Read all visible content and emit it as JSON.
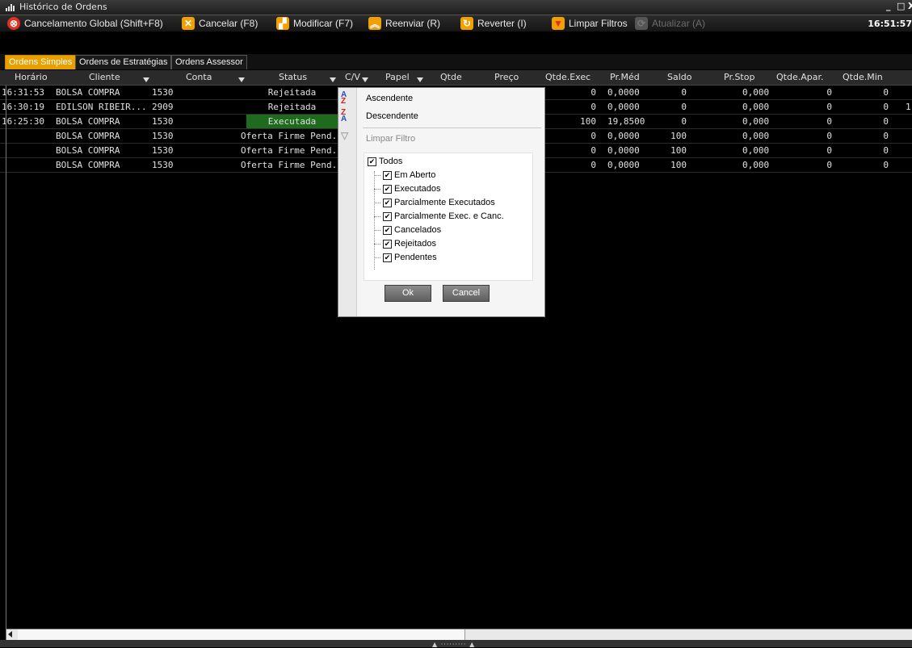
{
  "window": {
    "title": "Histórico de Ordens",
    "minimize": "_",
    "maximize": "□",
    "close": "X"
  },
  "toolbar": {
    "global_cancel": "Cancelamento Global (Shift+F8)",
    "cancel": "Cancelar (F8)",
    "modify": "Modificar (F7)",
    "resend": "Reenviar (R)",
    "revert": "Reverter (I)",
    "clear_filters": "Limpar Filtros",
    "refresh": "Atualizar (A)",
    "clock": "16:51:57"
  },
  "tabs": [
    "Ordens Simples",
    "Ordens de Estratégias",
    "Ordens Assessor"
  ],
  "columns": [
    "Horário",
    "Cliente",
    "Conta",
    "Status",
    "C/V",
    "Papel",
    "Qtde",
    "Preço",
    "Qtde.Exec",
    "Pr.Méd",
    "Saldo",
    "Pr.Stop",
    "Qtde.Apar.",
    "Qtde.Min"
  ],
  "rows": [
    {
      "horario": "16:31:53",
      "cliente": "BOLSA COMPRA",
      "conta": "1530",
      "status": "Rejeitada",
      "qtde_exec": "0",
      "pr_med": "0,0000",
      "saldo": "0",
      "pr_stop": "0,000",
      "qtde_apar": "0",
      "qtde_min": "0",
      "extra": ""
    },
    {
      "horario": "16:30:19",
      "cliente": "EDILSON RIBEIR...",
      "conta": "2909",
      "status": "Rejeitada",
      "qtde_exec": "0",
      "pr_med": "0,0000",
      "saldo": "0",
      "pr_stop": "0,000",
      "qtde_apar": "0",
      "qtde_min": "0",
      "extra": "1"
    },
    {
      "horario": "16:25:30",
      "cliente": "BOLSA COMPRA",
      "conta": "1530",
      "status": "Executada",
      "qtde_exec": "100",
      "pr_med": "19,8500",
      "saldo": "0",
      "pr_stop": "0,000",
      "qtde_apar": "0",
      "qtde_min": "0",
      "extra": ""
    },
    {
      "horario": "",
      "cliente": "BOLSA COMPRA",
      "conta": "1530",
      "status": "Oferta Firme Pend.",
      "qtde_exec": "0",
      "pr_med": "0,0000",
      "saldo": "100",
      "pr_stop": "0,000",
      "qtde_apar": "0",
      "qtde_min": "0",
      "extra": ""
    },
    {
      "horario": "",
      "cliente": "BOLSA COMPRA",
      "conta": "1530",
      "status": "Oferta Firme Pend.",
      "qtde_exec": "0",
      "pr_med": "0,0000",
      "saldo": "100",
      "pr_stop": "0,000",
      "qtde_apar": "0",
      "qtde_min": "0",
      "extra": ""
    },
    {
      "horario": "",
      "cliente": "BOLSA COMPRA",
      "conta": "1530",
      "status": "Oferta Firme Pend.",
      "qtde_exec": "0",
      "pr_med": "0,0000",
      "saldo": "100",
      "pr_stop": "0,000",
      "qtde_apar": "0",
      "qtde_min": "0",
      "extra": ""
    }
  ],
  "colors": {
    "executada_bg": "#1e6b1e",
    "active_tab": "#e8a000",
    "cancel_red": "#e03020",
    "orange": "#f0a000"
  },
  "filter_menu": {
    "ascending": "Ascendente",
    "descending": "Descendente",
    "clear_filter": "Limpar Filtro",
    "options": [
      {
        "label": "Todos",
        "checked": true
      },
      {
        "label": "Em Aberto",
        "checked": true
      },
      {
        "label": "Executados",
        "checked": true
      },
      {
        "label": "Parcialmente Executados",
        "checked": true
      },
      {
        "label": "Parcialmente Exec. e Canc.",
        "checked": true
      },
      {
        "label": "Cancelados",
        "checked": true
      },
      {
        "label": "Rejeitados",
        "checked": true
      },
      {
        "label": "Pendentes",
        "checked": true
      }
    ],
    "ok": "Ok",
    "cancel": "Cancel"
  }
}
